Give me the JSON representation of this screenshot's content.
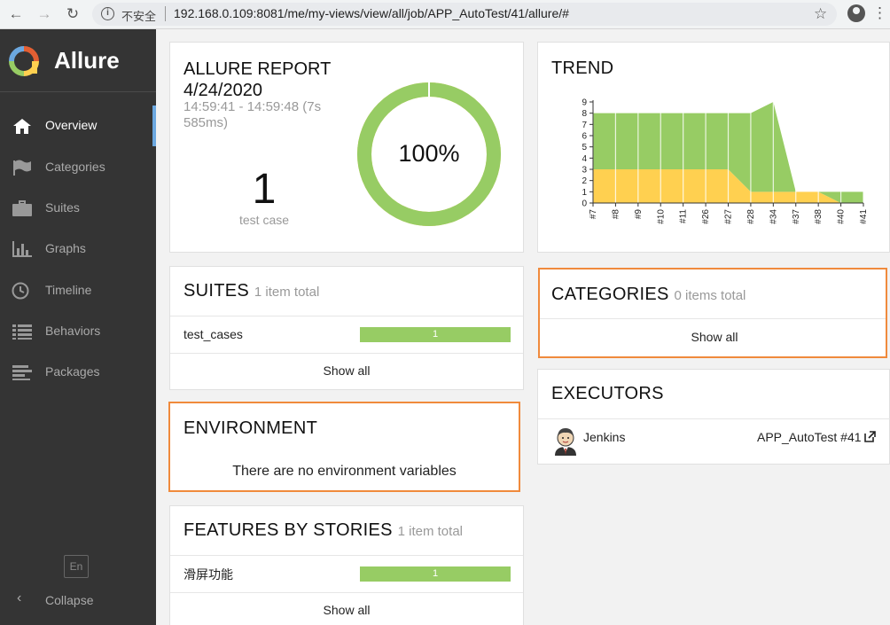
{
  "browser": {
    "security_text": "不安全",
    "url": "192.168.0.109:8081/me/my-views/view/all/job/APP_AutoTest/41/allure/#"
  },
  "sidebar": {
    "brand": "Allure",
    "items": [
      {
        "label": "Overview",
        "icon": "home-icon",
        "active": true
      },
      {
        "label": "Categories",
        "icon": "flag-icon"
      },
      {
        "label": "Suites",
        "icon": "briefcase-icon"
      },
      {
        "label": "Graphs",
        "icon": "bar-chart-icon"
      },
      {
        "label": "Timeline",
        "icon": "clock-icon"
      },
      {
        "label": "Behaviors",
        "icon": "list-icon"
      },
      {
        "label": "Packages",
        "icon": "packages-icon"
      }
    ],
    "language": "En",
    "collapse_label": "Collapse"
  },
  "report": {
    "title": "ALLURE REPORT",
    "date": "4/24/2020",
    "time_range": "14:59:41 - 14:59:48 (7s",
    "duration": "585ms)",
    "test_count": "1",
    "test_count_label": "test case",
    "pass_rate": "100%",
    "pass_fraction": 1.0,
    "colors": {
      "passed": "#97cc64",
      "broken": "#ffd050"
    }
  },
  "suites": {
    "title": "SUITES",
    "subtitle": "1 item total",
    "items": [
      {
        "name": "test_cases",
        "count": "1"
      }
    ],
    "show_all": "Show all"
  },
  "environment": {
    "title": "ENVIRONMENT",
    "message": "There are no environment variables"
  },
  "features": {
    "title": "FEATURES BY STORIES",
    "subtitle": "1 item total",
    "items": [
      {
        "name": "滑屏功能",
        "count": "1"
      }
    ],
    "show_all": "Show all"
  },
  "trend": {
    "title": "TREND"
  },
  "categories": {
    "title": "CATEGORIES",
    "subtitle": "0 items total",
    "show_all": "Show all"
  },
  "executors": {
    "title": "EXECUTORS",
    "name": "Jenkins",
    "build": "APP_AutoTest #41"
  },
  "chart_data": {
    "type": "area",
    "title": "TREND",
    "categories": [
      "#7",
      "#8",
      "#9",
      "#10",
      "#11",
      "#26",
      "#27",
      "#28",
      "#34",
      "#37",
      "#38",
      "#40",
      "#41"
    ],
    "series": [
      {
        "values": [
          3,
          3,
          3,
          3,
          3,
          3,
          3,
          1,
          1,
          1,
          1,
          0,
          0
        ],
        "color": "#ffd050"
      },
      {
        "values": [
          5,
          5,
          5,
          5,
          5,
          5,
          5,
          7,
          8,
          0,
          0,
          1,
          1
        ],
        "color": "#97cc64"
      }
    ],
    "stacked": true,
    "ylim": [
      0,
      9
    ],
    "yticks": [
      "0",
      "1",
      "2",
      "3",
      "4",
      "5",
      "6",
      "7",
      "8",
      "9"
    ],
    "grid": true
  }
}
